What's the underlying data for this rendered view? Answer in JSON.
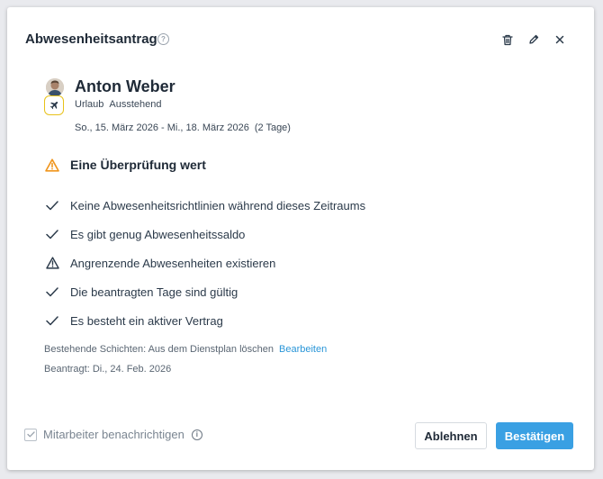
{
  "dialog": {
    "title": "Abwesenheitsantrag",
    "help_glyph": "?"
  },
  "header_actions": {
    "delete_icon": "trash-icon",
    "edit_icon": "pencil-icon",
    "close_icon": "close-icon"
  },
  "employee": {
    "name": "Anton Weber",
    "absence_type": "Urlaub",
    "status": "Ausstehend",
    "type_icon": "airplane-icon",
    "date_range": "So., 15. März 2026 - Mi., 18. März 2026",
    "duration": "(2 Tage)"
  },
  "review": {
    "title": "Eine Überprüfung wert",
    "items": [
      {
        "icon": "check-icon",
        "text": "Keine Abwesenheitsrichtlinien während dieses Zeitraums"
      },
      {
        "icon": "check-icon",
        "text": "Es gibt genug Abwesenheitssaldo"
      },
      {
        "icon": "warning-icon",
        "text": "Angrenzende Abwesenheiten existieren"
      },
      {
        "icon": "check-icon",
        "text": "Die beantragten Tage sind gültig"
      },
      {
        "icon": "check-icon",
        "text": "Es besteht ein aktiver Vertrag"
      }
    ]
  },
  "shifts": {
    "text": "Bestehende Schichten: Aus dem Dienstplan löschen",
    "link": "Bearbeiten"
  },
  "requested": "Beantragt: Di., 24. Feb. 2026",
  "footer": {
    "notify_label": "Mitarbeiter benachrichtigen",
    "notify_checked": true,
    "info_glyph": "i",
    "reject_label": "Ablehnen",
    "confirm_label": "Bestätigen"
  },
  "colors": {
    "accent": "#3aa0e3",
    "link": "#2a96d8",
    "warning": "#f0961e",
    "badge_border": "#e8c21a"
  }
}
